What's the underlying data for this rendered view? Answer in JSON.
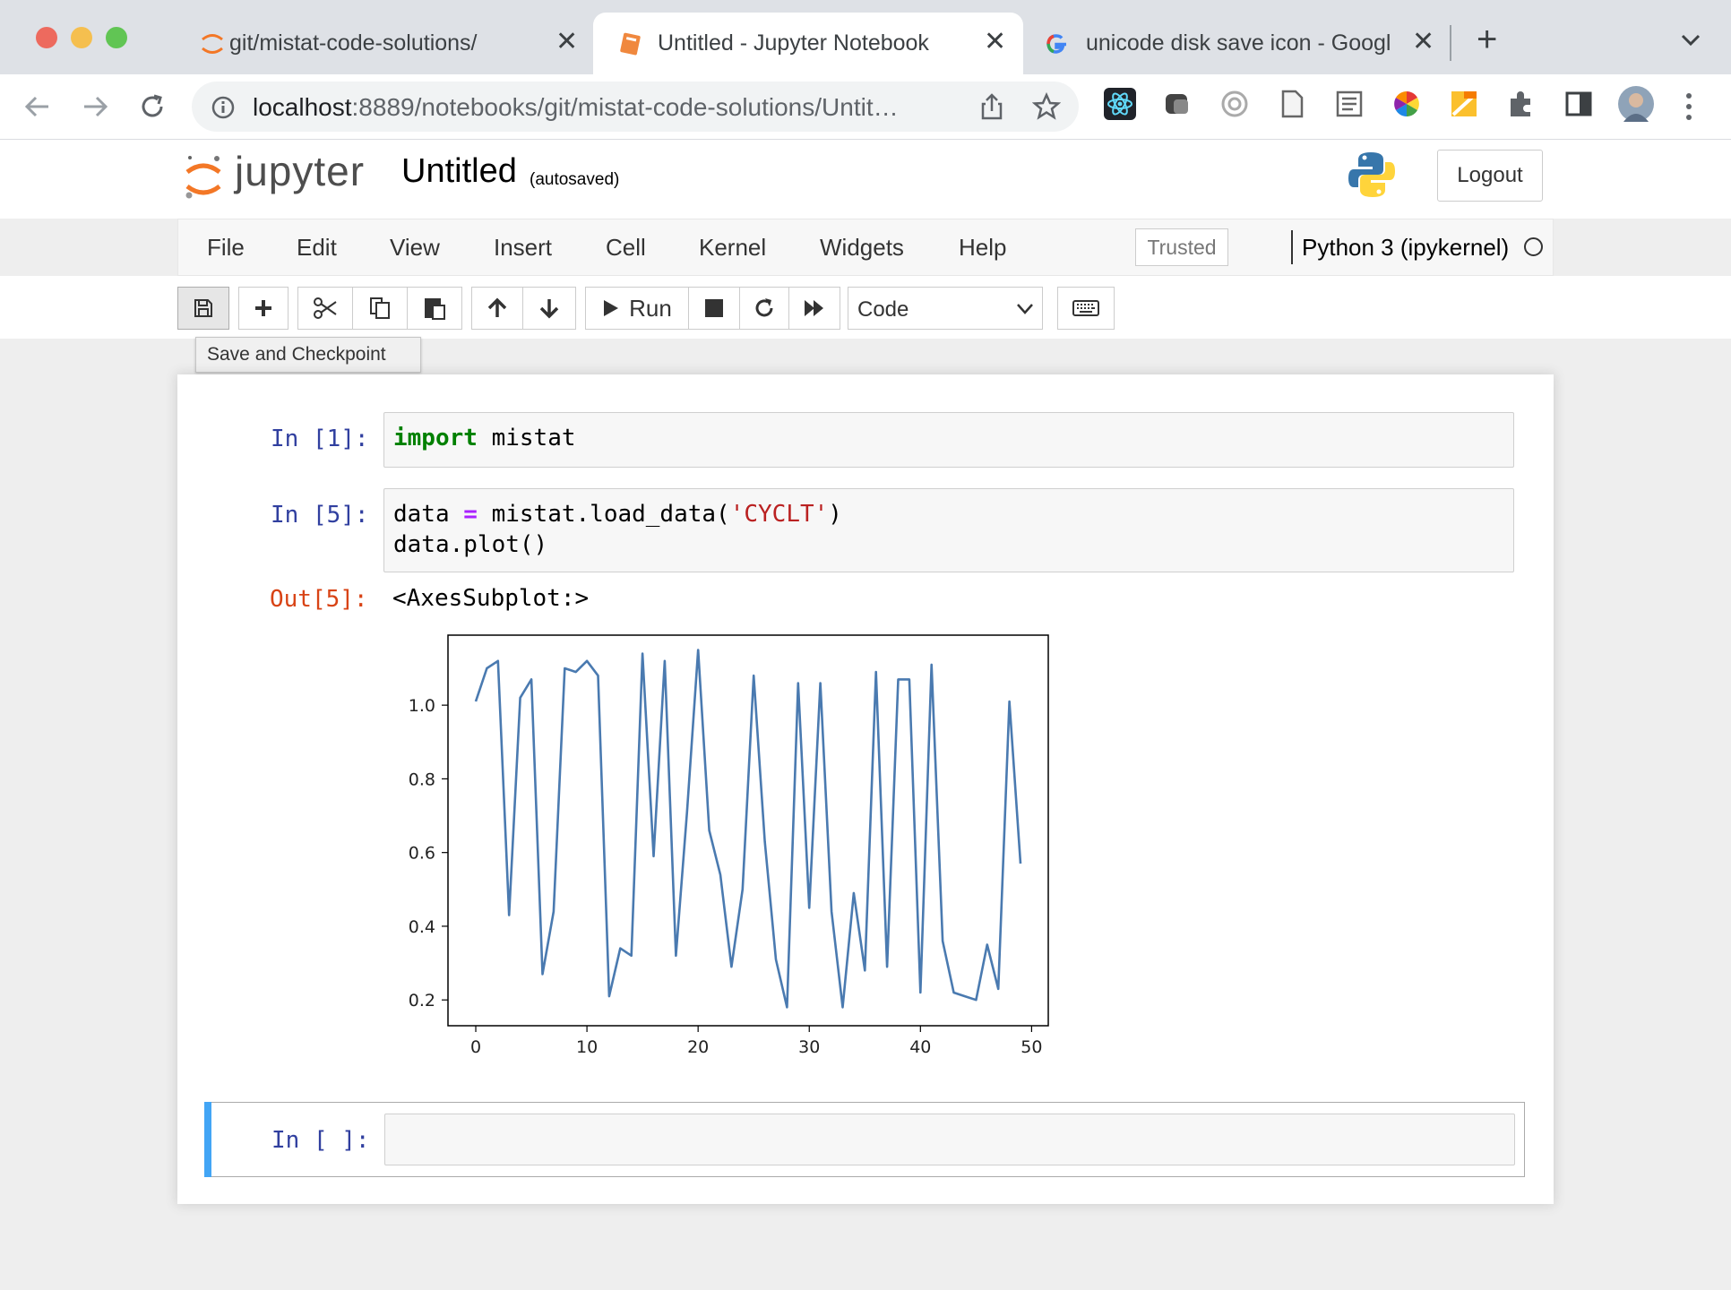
{
  "browser": {
    "tabs": [
      {
        "title": "git/mistat-code-solutions/",
        "icon": "jupyter-icon",
        "active": false
      },
      {
        "title": "Untitled - Jupyter Notebook",
        "icon": "notebook-icon",
        "active": true
      },
      {
        "title": "unicode disk save icon - Googl",
        "icon": "google-icon",
        "active": false
      }
    ],
    "new_tab_symbol": "+",
    "close_symbol": "✕",
    "url_host": "localhost",
    "url_rest": ":8889/notebooks/git/mistat-code-solutions/Untit…"
  },
  "jupyter": {
    "logo_text": "jupyter",
    "notebook_title": "Untitled",
    "autosave_status": "(autosaved)",
    "logout_label": "Logout",
    "menu": [
      "File",
      "Edit",
      "View",
      "Insert",
      "Cell",
      "Kernel",
      "Widgets",
      "Help"
    ],
    "trusted_label": "Trusted",
    "kernel_name": "Python 3 (ipykernel)",
    "toolbar": {
      "run_label": "Run",
      "cell_type": "Code",
      "cell_type_options": [
        "Code"
      ],
      "tooltip": "Save and Checkpoint"
    }
  },
  "cells": [
    {
      "prompt": "In [1]:",
      "lines": [
        [
          {
            "t": "import",
            "c": "kw"
          },
          {
            "t": " mistat",
            "c": ""
          }
        ]
      ]
    },
    {
      "prompt": "In [5]:",
      "lines": [
        [
          {
            "t": "data ",
            "c": ""
          },
          {
            "t": "=",
            "c": "op"
          },
          {
            "t": " mistat.load_data(",
            "c": ""
          },
          {
            "t": "'CYCLT'",
            "c": "str"
          },
          {
            "t": ")",
            "c": ""
          }
        ],
        [
          {
            "t": "data.plot()",
            "c": ""
          }
        ]
      ]
    },
    {
      "prompt": "In [ ]:",
      "lines": []
    }
  ],
  "output": {
    "prompt": "Out[5]:",
    "text": "<AxesSubplot:>"
  },
  "chart_data": {
    "type": "line",
    "title": "",
    "xlabel": "",
    "ylabel": "",
    "xlim": [
      -2.5,
      51.5
    ],
    "ylim": [
      0.13,
      1.19
    ],
    "xticks": [
      0,
      10,
      20,
      30,
      40,
      50
    ],
    "yticks": [
      0.2,
      0.4,
      0.6,
      0.8,
      1.0
    ],
    "xtick_labels": [
      "0",
      "10",
      "20",
      "30",
      "40",
      "50"
    ],
    "ytick_labels": [
      "0.2",
      "0.4",
      "0.6",
      "0.8",
      "1.0"
    ],
    "grid": false,
    "legend": false,
    "series": [
      {
        "color": "#4a7ab0",
        "x": [
          0,
          1,
          2,
          3,
          4,
          5,
          6,
          7,
          8,
          9,
          10,
          11,
          12,
          13,
          14,
          15,
          16,
          17,
          18,
          19,
          20,
          21,
          22,
          23,
          24,
          25,
          26,
          27,
          28,
          29,
          30,
          31,
          32,
          33,
          34,
          35,
          36,
          37,
          38,
          39,
          40,
          41,
          42,
          43,
          44,
          45,
          46,
          47,
          48,
          49
        ],
        "values": [
          1.01,
          1.1,
          1.12,
          0.43,
          1.02,
          1.07,
          0.27,
          0.44,
          1.1,
          1.09,
          1.12,
          1.08,
          0.21,
          0.34,
          0.32,
          1.14,
          0.59,
          1.12,
          0.32,
          0.71,
          1.15,
          0.66,
          0.54,
          0.29,
          0.5,
          1.08,
          0.63,
          0.31,
          0.18,
          1.06,
          0.45,
          1.06,
          0.44,
          0.18,
          0.49,
          0.28,
          1.09,
          0.29,
          1.07,
          1.07,
          0.22,
          1.11,
          0.36,
          0.22,
          0.21,
          0.2,
          0.35,
          0.23,
          1.01,
          0.57
        ]
      }
    ]
  }
}
